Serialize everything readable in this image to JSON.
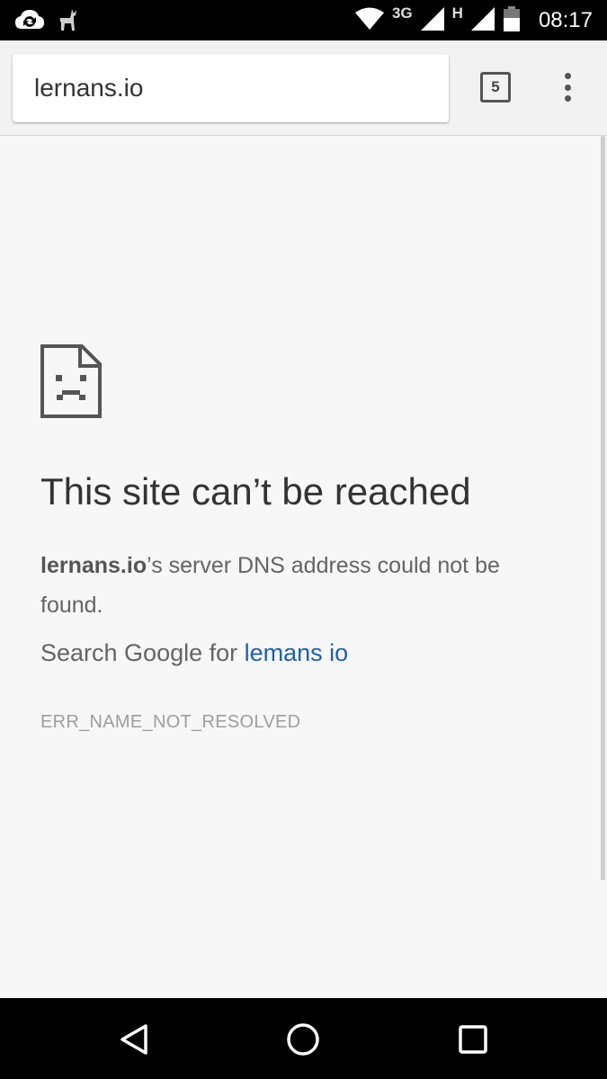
{
  "status_bar": {
    "network_3g": "3G",
    "network_h": "H",
    "time": "08:17",
    "icons": [
      "cloud-sync-icon",
      "deer-icon",
      "wifi-icon",
      "signal-3g-icon",
      "signal-h-icon",
      "battery-icon"
    ]
  },
  "toolbar": {
    "url": "lernans.io",
    "tab_count": "5",
    "menu_icon": "more-vert-icon"
  },
  "error_page": {
    "icon": "sad-page-icon",
    "title": "This site can’t be reached",
    "host": "lernans.io",
    "message_suffix": "’s server DNS address could not be found.",
    "search_prefix": "Search Google for ",
    "search_query": "lemans io",
    "error_code": "ERR_NAME_NOT_RESOLVED"
  },
  "nav_bar": {
    "icons": [
      "back-icon",
      "home-icon",
      "recents-icon"
    ]
  }
}
